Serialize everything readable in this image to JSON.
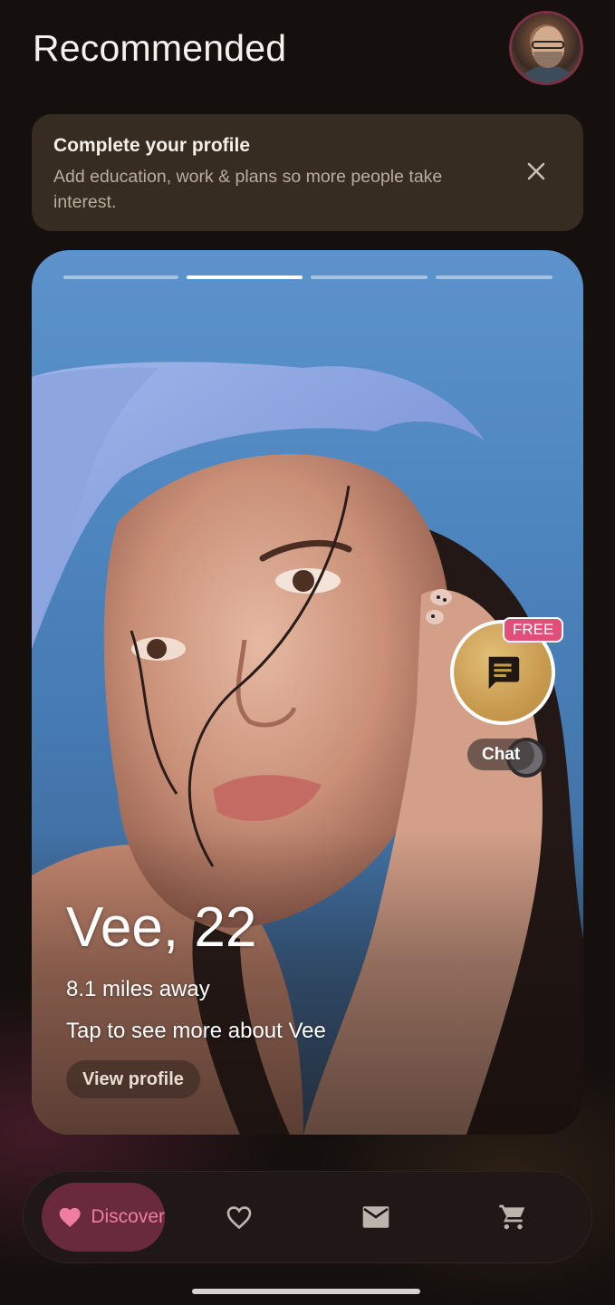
{
  "header": {
    "title": "Recommended"
  },
  "banner": {
    "title": "Complete your profile",
    "text": "Add education, work & plans so more people take interest."
  },
  "profile": {
    "name_age": "Vee, 22",
    "distance": "8.1 miles away",
    "tap_hint": "Tap to see more about Vee",
    "view_profile_label": "View profile",
    "photo_count": 4,
    "current_photo_index": 2
  },
  "chat": {
    "badge": "FREE",
    "label": "Chat"
  },
  "nav": {
    "items": [
      {
        "label": "Discover",
        "icon": "heart-filled-icon",
        "active": true
      },
      {
        "label": "",
        "icon": "heart-outline-icon",
        "active": false
      },
      {
        "label": "",
        "icon": "mail-icon",
        "active": false
      },
      {
        "label": "",
        "icon": "cart-icon",
        "active": false
      }
    ]
  },
  "colors": {
    "background": "#15100e",
    "banner": "#372c21",
    "accent_pink": "#ef7ea1",
    "discover_pill": "#6a2a3e",
    "chat_gold": "#c89a4f",
    "free_badge": "#e04f79"
  }
}
